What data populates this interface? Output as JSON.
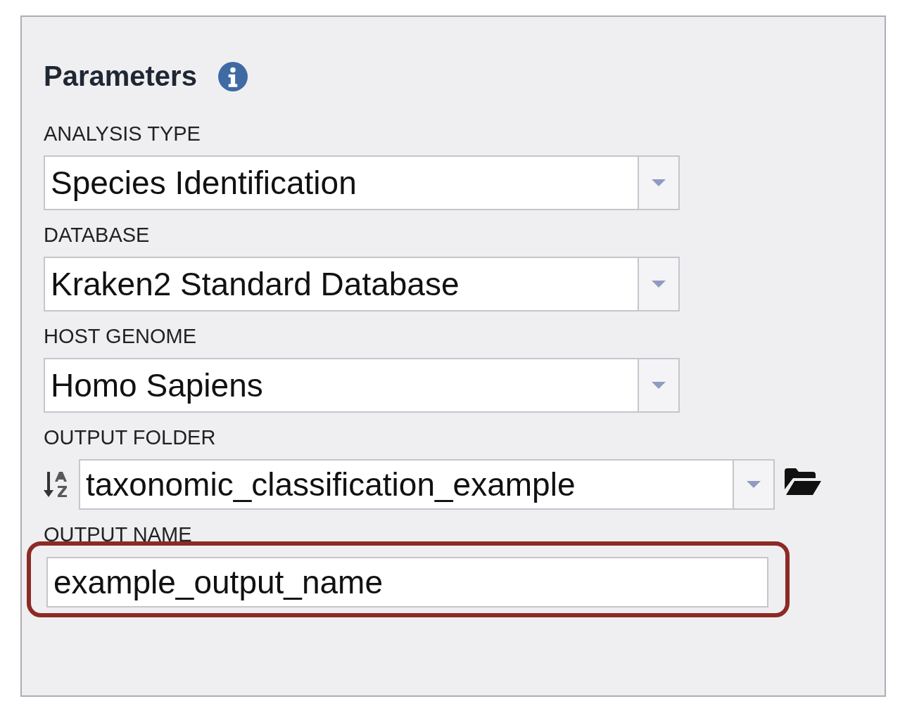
{
  "panel": {
    "title": "Parameters"
  },
  "fields": [
    {
      "kind": "select",
      "label": "ANALYSIS TYPE",
      "value": "Species Identification"
    },
    {
      "kind": "select",
      "label": "DATABASE",
      "value": "Kraken2 Standard Database"
    },
    {
      "kind": "select",
      "label": "HOST GENOME",
      "value": "Homo Sapiens"
    },
    {
      "kind": "folder",
      "label": "OUTPUT FOLDER",
      "value": "taxonomic_classification_example"
    },
    {
      "kind": "text",
      "label": "OUTPUT NAME",
      "value": "example_output_name",
      "highlighted": true
    }
  ]
}
